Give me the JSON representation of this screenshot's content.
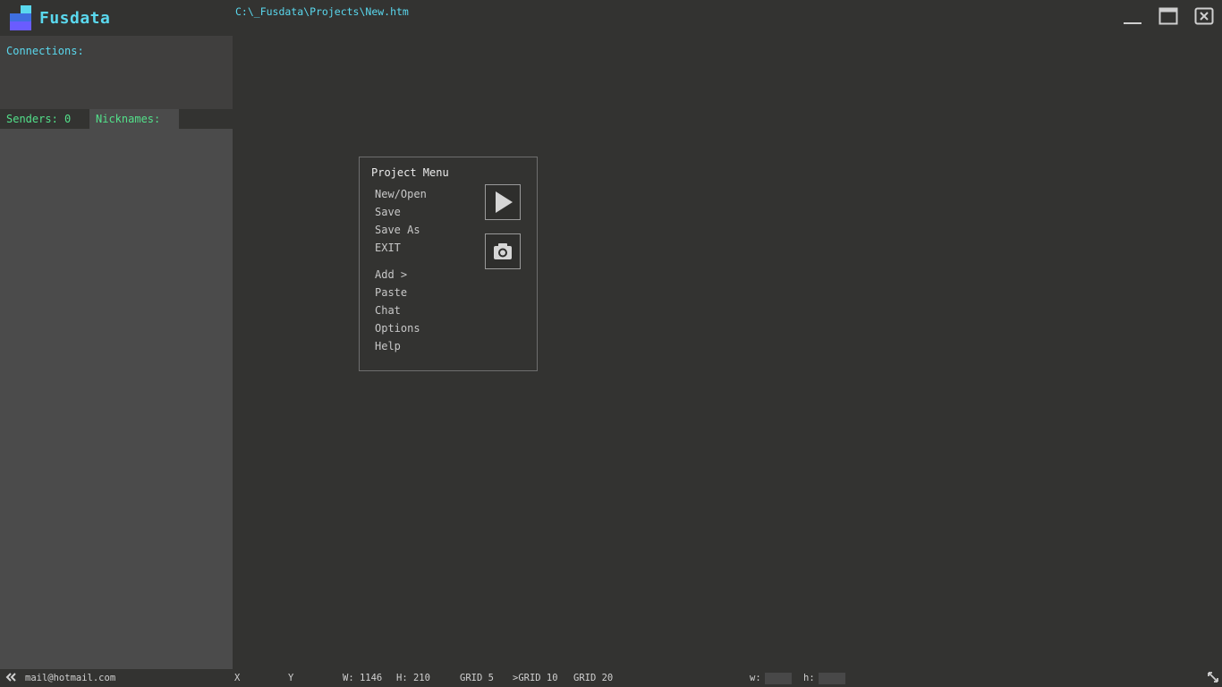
{
  "app": {
    "title": "Fusdata",
    "file_path": "C:\\_Fusdata\\Projects\\New.htm",
    "logo_colors": [
      "#5ad8ee",
      "#6a5cff",
      "#3f6fe0"
    ]
  },
  "window_controls": {
    "minimize_icon": "minimize-icon",
    "maximize_icon": "maximize-icon",
    "close_icon": "close-icon"
  },
  "sidebar": {
    "connections_label": "Connections:",
    "tabs": {
      "senders": "Senders: 0",
      "nicknames": "Nicknames:"
    }
  },
  "project_menu": {
    "title": "Project Menu",
    "items": {
      "new_open": "New/Open",
      "save": "Save",
      "save_as": "Save As",
      "exit": "EXIT",
      "add": "Add >",
      "paste": "Paste",
      "chat": "Chat",
      "options": "Options",
      "help": "Help"
    },
    "play_icon": "play-icon",
    "camera_icon": "camera-icon"
  },
  "statusbar": {
    "collapse_icon": "double-chevron-left-icon",
    "email": "mail@hotmail.com",
    "x_label": "X",
    "y_label": "Y",
    "width": "W: 1146",
    "height": "H: 210",
    "grid5": "GRID 5",
    "grid10": ">GRID 10",
    "grid20": "GRID 20",
    "w_label": "w:",
    "h_label": "h:",
    "w_value": "",
    "h_value": "",
    "resize_icon": "resize-diagonal-icon"
  },
  "colors": {
    "accent_cyan": "#5ad8ee",
    "accent_green": "#53e08a",
    "background": "#333331",
    "sidebar": "#4b4b4b"
  }
}
